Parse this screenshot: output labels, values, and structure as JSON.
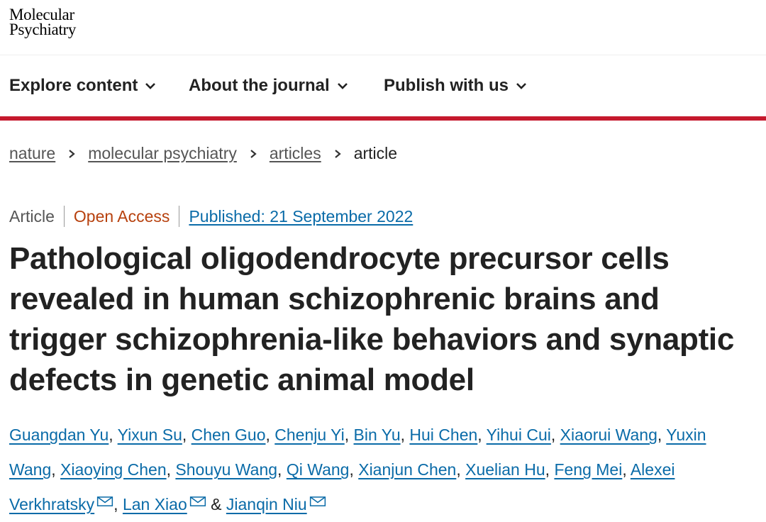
{
  "logo": {
    "line1": "Molecular",
    "line2": "Psychiatry"
  },
  "nav": {
    "items": [
      {
        "label": "Explore content"
      },
      {
        "label": "About the journal"
      },
      {
        "label": "Publish with us"
      }
    ]
  },
  "breadcrumb": {
    "items": [
      "nature",
      "molecular psychiatry",
      "articles"
    ],
    "current": "article"
  },
  "meta": {
    "type": "Article",
    "access": "Open Access",
    "published": "Published: 21 September 2022"
  },
  "article": {
    "title": "Pathological oligodendrocyte precursor cells revealed in human schizophrenic brains and trigger schizophrenia-like behaviors and synaptic defects in genetic animal model"
  },
  "authors": {
    "names": [
      "Guangdan Yu",
      "Yixun Su",
      "Chen Guo",
      "Chenju Yi",
      "Bin Yu",
      "Hui Chen",
      "Yihui Cui",
      "Xiaorui Wang",
      "Yuxin Wang",
      "Xiaoying Chen",
      "Shouyu Wang",
      "Qi Wang",
      "Xianjun Chen",
      "Xuelian Hu",
      "Feng Mei",
      "Alexei Verkhratsky",
      "Lan Xiao",
      "Jianqin Niu"
    ],
    "separator": ",",
    "ampersand": "&"
  },
  "colors": {
    "brand_red": "#c5192d",
    "link_blue": "#0a6ba8",
    "open_access_orange": "#b7410e"
  },
  "icons": {
    "nav_chevron": "chevron-down-icon",
    "breadcrumb_sep": "chevron-right-icon",
    "author_contact": "mail-icon"
  }
}
